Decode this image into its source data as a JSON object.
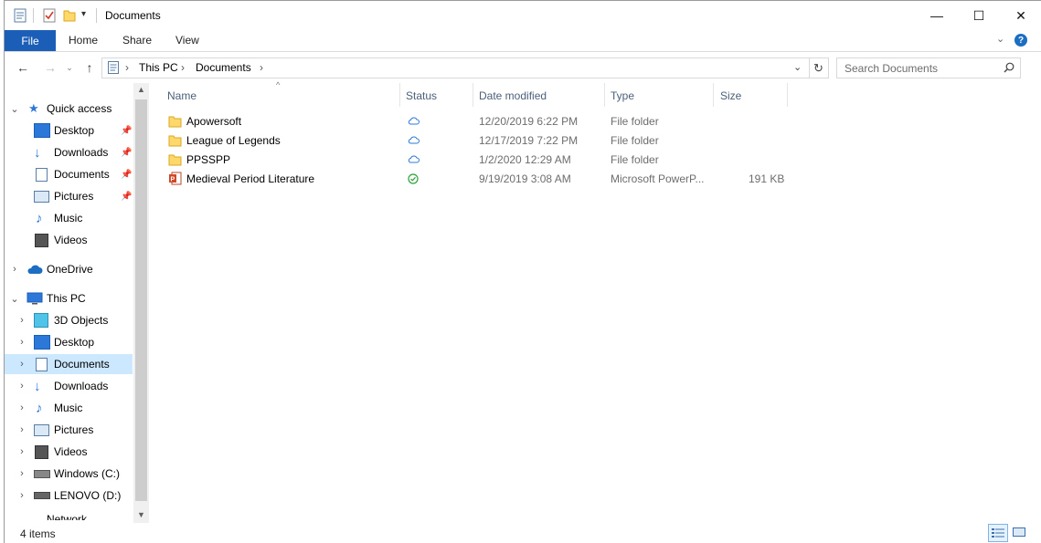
{
  "window": {
    "title": "Documents"
  },
  "title_buttons": {
    "minimize": "—",
    "maximize": "☐",
    "close": "✕"
  },
  "ribbon": {
    "tabs": [
      "File",
      "Home",
      "Share",
      "View"
    ]
  },
  "address": {
    "crumbs": [
      "This PC",
      "Documents"
    ]
  },
  "search": {
    "placeholder": "Search Documents"
  },
  "nav": {
    "quick_access": "Quick access",
    "quick_items": [
      "Desktop",
      "Downloads",
      "Documents",
      "Pictures",
      "Music",
      "Videos"
    ],
    "onedrive": "OneDrive",
    "this_pc": "This PC",
    "pc_items": [
      "3D Objects",
      "Desktop",
      "Documents",
      "Downloads",
      "Music",
      "Pictures",
      "Videos",
      "Windows (C:)",
      "LENOVO (D:)"
    ],
    "network": "Network"
  },
  "columns": [
    "Name",
    "Status",
    "Date modified",
    "Type",
    "Size"
  ],
  "files": [
    {
      "name": "Apowersoft",
      "date": "12/20/2019 6:22 PM",
      "type": "File folder",
      "size": "",
      "status": "cloud"
    },
    {
      "name": "League of Legends",
      "date": "12/17/2019 7:22 PM",
      "type": "File folder",
      "size": "",
      "status": "cloud"
    },
    {
      "name": "PPSSPP",
      "date": "1/2/2020 12:29 AM",
      "type": "File folder",
      "size": "",
      "status": "cloud"
    },
    {
      "name": "Medieval Period Literature",
      "date": "9/19/2019 3:08 AM",
      "type": "Microsoft PowerP...",
      "size": "191 KB",
      "status": "available"
    }
  ],
  "statusbar": {
    "count": "4 items"
  },
  "colors": {
    "accent": "#1b5eb8",
    "selection": "#cce8ff",
    "folder": "#ffd86b",
    "cloud": "#2b78d8",
    "ok": "#2aa13b"
  }
}
